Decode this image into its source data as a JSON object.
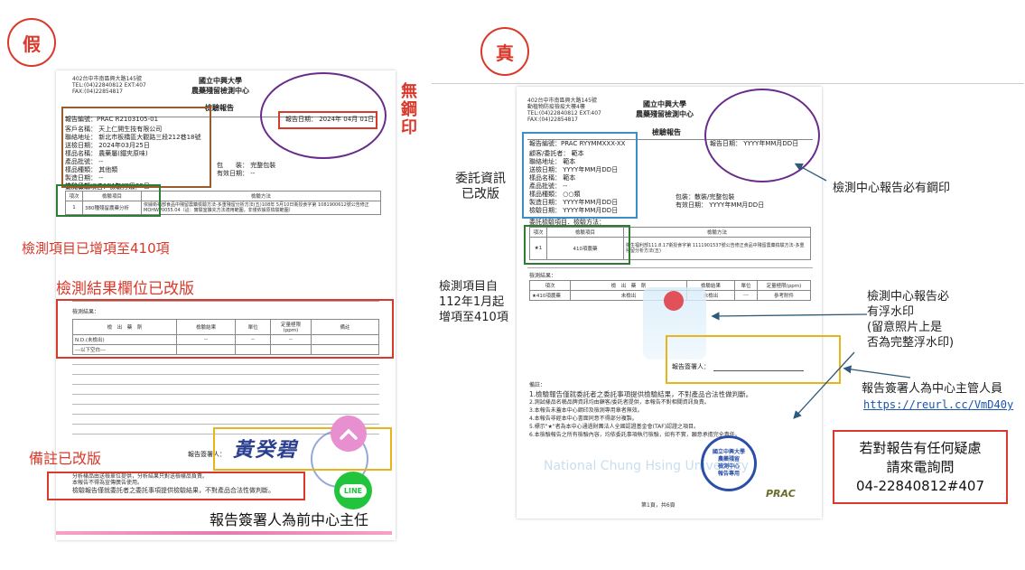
{
  "left": {
    "label": "假",
    "doc": {
      "addr": [
        "402台中市南區興大路145號",
        "TEL:(04)22840812 EXT:407",
        "FAX:(04)22854817"
      ],
      "org": [
        "國立中興大學",
        "農藥殘留檢測中心"
      ],
      "title": "檢驗報告",
      "report_no": "報告編號：PRAC R2103105-01",
      "report_date": "報告日期： 2024年 04月 01日",
      "info": [
        "客戶名稱： 天上仁開生技有限公司",
        "聯絡地址： 新北市板橋區大觀路三段212巷18號",
        "送檢日期： 2024年03月25日",
        "樣品名稱： 農藥屬(鐵夾原味)",
        "產品批號： --",
        "樣品種類： 其他類",
        "製造日期： --",
        "檢驗日期： 2024年03月25日"
      ],
      "pack": [
        "包　　裝： 完整包裝",
        "有效日期： --"
      ],
      "item_header": "委託檢驗項目．檢驗方法：",
      "item_cols": [
        "項次",
        "檢驗項目",
        "檢驗方法"
      ],
      "item_row": [
        "1",
        "380種殘留農藥分析",
        "依據衛福部食品中殘留農藥檢驗方法-多重殘留分析方法(五)108年 5月10日衛授食字第 1081900612號公告修正MOHWP0055.04（註：實驗室擴充方法適用範圍，非僅依據原檢驗範圍）"
      ],
      "result_title": "檢測結果：",
      "result_cols": [
        "檢　出　藥　劑",
        "檢驗結果",
        "單位",
        "定量極限 (ppm)",
        "備註"
      ],
      "result_rows": [
        [
          "N.D.(未檢出)",
          "--",
          "--",
          "--",
          ""
        ],
        [
          "---以下空白---",
          "",
          "",
          "",
          ""
        ]
      ],
      "signer_label": "報告簽署人：",
      "signature": "黃癸碧",
      "notes": [
        "分析樣品由送檢單位提供，分析結果只對送檢樣品負責。",
        "本報告不得為宣傳廣告使用。",
        "檢驗報告僅就委託者之委託事項提供檢驗結果，不對產品合法性做判斷。"
      ]
    },
    "annotations": {
      "no_seal": "無鋼印",
      "items_added": "檢測項目已增項至410項",
      "result_changed": "檢測結果欄位已改版",
      "remark_changed": "備註已改版",
      "signer_former": "報告簽署人為前中心主任"
    }
  },
  "right": {
    "label": "真",
    "doc": {
      "addr": [
        "402台中市南區興大路145號",
        "動植物防疫檢疫大樓4樓",
        "TEL:(04)22840812 EXT:407",
        "FAX:(04)22854817"
      ],
      "org": [
        "國立中興大學",
        "農藥殘留檢測中心"
      ],
      "title": "檢驗報告",
      "report_no": "報告編號：PRAC RYYMMXXX-XX",
      "report_date": "報告日期： YYYY年MM月DD日",
      "info": [
        "顧客/委託者： 範本",
        "聯絡地址： 範本",
        "送檢日期： YYYY年MM月DD日",
        "樣品名稱： 範本",
        "產品批號： --",
        "樣品種類： ○○類",
        "製造日期： YYYY年MM月DD日",
        "檢驗日期： YYYY年MM月DD日"
      ],
      "pack": [
        "包裝：散裝/完整包裝",
        "有效日期： YYYY年MM月DD日"
      ],
      "item_header": "委託檢驗項目．檢驗方法：",
      "item_cols": [
        "項次",
        "檢驗項目",
        "檢驗方法"
      ],
      "item_row": [
        "★1",
        "410項農藥",
        "衛生福利部111.8.17衛授食字第 1111901537號公告修正食品中殘留農藥檢驗方法-多重殘留分析方法(五)"
      ],
      "result_title": "檢測結果：",
      "result_cols": [
        "項次",
        "檢　出　藥　劑",
        "檢驗結果",
        "單位",
        "定量極限(ppm)"
      ],
      "result_row": [
        "★410項農藥",
        "未檢出",
        "未檢出",
        "---",
        "參考附件"
      ],
      "signer_label": "報告簽署人：",
      "notes_title": "備註：",
      "notes": [
        "1.檢驗報告僅就委託者之委託事項提供檢驗結果，不對產品合法性做判斷。",
        "2.測試樣品名稱品牌資訊均由顧客/委託者提供，本報告不對相關資訊負責。",
        "3.本報告未蓋本中心鋼印及檢測專用章者無效。",
        "4.本報告非經本中心書面同意不得部分複製。",
        "5.標示\"★\"者為本中心通過財團法人全國認證基金會(TAF)認證之項目。",
        "6.本檢驗報告之所有檢驗內容，均依委託事項執行檢驗，如有不實，願意承擔完全責任。"
      ],
      "watermark": "National Chung Hsing University",
      "seal": [
        "國立中興大學",
        "農藥殘留",
        "檢測中心",
        "報告專用"
      ],
      "page": "第1頁，共6頁",
      "logo": "PRAC"
    },
    "annotations": {
      "client_changed": [
        "委託資訊",
        "已改版"
      ],
      "seal_required": "檢測中心報告必有鋼印",
      "items_since": [
        "檢測項目自",
        "112年1月起",
        "增項至410項"
      ],
      "watermark_note": [
        "檢測中心報告必",
        "有浮水印",
        "(留意照片上是",
        "否為完整浮水印)"
      ],
      "signer_note": "報告簽署人為中心主管人員",
      "link": "https://reurl.cc/VmD40y",
      "contact": [
        "若對報告有任何疑慮",
        "請來電詢問",
        "04-22840812#407"
      ]
    }
  },
  "colors": {
    "red": "#d9392b",
    "brown": "#9a5a2a",
    "green": "#2f7d32",
    "purple": "#6a2c8c",
    "blue": "#3a8fc8",
    "yellow": "#e8b41c"
  },
  "icons": {
    "back_to_top": "chevron-up-icon",
    "line": "line-chat-icon"
  },
  "line_label": "LINE"
}
